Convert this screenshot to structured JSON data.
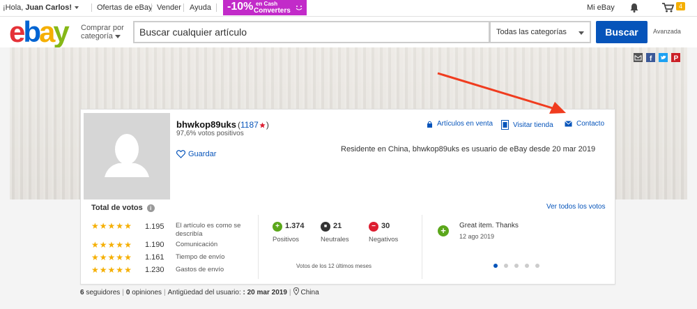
{
  "topbar": {
    "greeting_prefix": "¡Hola, ",
    "user": "Juan Carlos!",
    "links": [
      "Ofertas de eBay",
      "Vender",
      "Ayuda"
    ],
    "promo_pct": "-10%",
    "promo_line1": "en Cash",
    "promo_line2": "Converters",
    "mi_ebay": "Mi eBay",
    "cart_count": "4"
  },
  "header": {
    "logo": [
      "e",
      "b",
      "a",
      "y"
    ],
    "shop_by_line1": "Comprar por",
    "shop_by_line2": "categoría",
    "search_placeholder": "Buscar cualquier artículo",
    "category": "Todas las categorías",
    "search_button": "Buscar",
    "advanced": "Avanzada"
  },
  "profile": {
    "username": "bhwkop89uks",
    "score_open": "(",
    "score": "1187",
    "score_close": ")",
    "positive_pct": "97,6% votos positivos",
    "save": "Guardar",
    "links": [
      "Artículos en venta",
      "Visitar tienda",
      "Contacto"
    ],
    "residence": "Residente en China, bhwkop89uks es usuario de eBay desde 20 mar 2019"
  },
  "ratings": {
    "title": "Total de votos",
    "see_all": "Ver todos los votos",
    "detailed": [
      {
        "count": "1.195",
        "label_1": "El artículo es como se",
        "label_2": "describía"
      },
      {
        "count": "1.190",
        "label_1": "Comunicación",
        "label_2": ""
      },
      {
        "count": "1.161",
        "label_1": "Tiempo de envío",
        "label_2": ""
      },
      {
        "count": "1.230",
        "label_1": "Gastos de envío",
        "label_2": ""
      }
    ],
    "summary": [
      {
        "count": "1.374",
        "label": "Positivos",
        "symbol": "+",
        "color": "#5ba71b"
      },
      {
        "count": "21",
        "label": "Neutrales",
        "symbol": "■",
        "color": "#333333"
      },
      {
        "count": "30",
        "label": "Negativos",
        "symbol": "−",
        "color": "#dd1e31"
      }
    ],
    "period": "Votos de los 12 últimos meses",
    "comment": "Great item. Thanks",
    "comment_date": "12 ago 2019",
    "comment_symbol": "+",
    "pager_pages": 5,
    "pager_active": 1
  },
  "footer": {
    "followers": "6",
    "followers_label": " seguidores",
    "reviews": "0",
    "reviews_label": " opiniones",
    "member_label": "Antigüedad del usuario: ",
    "member_since": ": 20 mar 2019",
    "location": "China"
  },
  "colors": {
    "ebay_blue": "#0654ba",
    "promo": "#c22bc9",
    "star": "#f5af02",
    "annotation_arrow": "#f03c1f"
  },
  "icons": [
    "chevron-down-icon",
    "bell-icon",
    "cart-icon",
    "mail-icon",
    "facebook-icon",
    "twitter-icon",
    "pinterest-icon",
    "heart-icon",
    "shop-icon",
    "store-icon",
    "envelope-icon",
    "info-icon",
    "location-pin-icon",
    "annotation-arrow"
  ]
}
